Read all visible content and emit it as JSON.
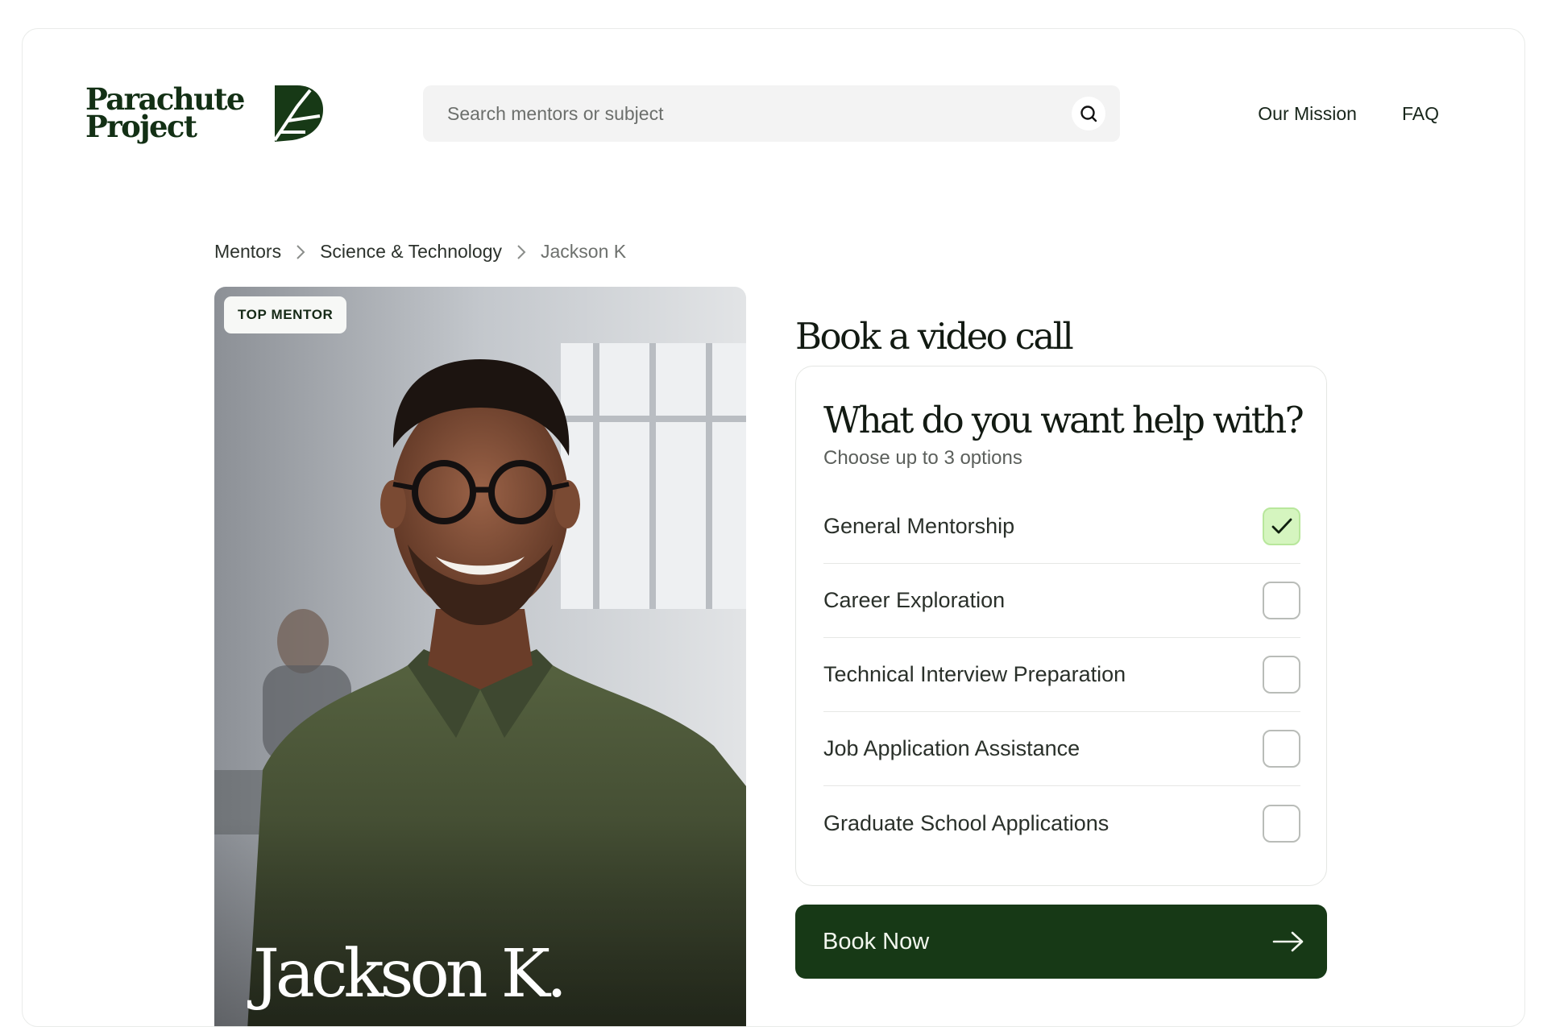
{
  "brand": {
    "line1": "Parachute",
    "line2": "Project"
  },
  "search": {
    "placeholder": "Search mentors or subject",
    "icon": "search-icon"
  },
  "nav": {
    "items": [
      {
        "label": "Our Mission"
      },
      {
        "label": "FAQ"
      }
    ]
  },
  "breadcrumb": [
    {
      "label": "Mentors"
    },
    {
      "label": "Science & Technology"
    },
    {
      "label": "Jackson K"
    }
  ],
  "mentor": {
    "badge": "TOP MENTOR",
    "name": "Jackson K."
  },
  "booking": {
    "title": "Book a video call",
    "question": "What do you want help with?",
    "hint": "Choose up to 3 options",
    "options": [
      {
        "label": "General Mentorship",
        "checked": true
      },
      {
        "label": "Career Exploration",
        "checked": false
      },
      {
        "label": "Technical Interview Preparation",
        "checked": false
      },
      {
        "label": "Job Application Assistance",
        "checked": false
      },
      {
        "label": "Graduate School Applications",
        "checked": false
      }
    ],
    "cta": "Book Now"
  },
  "colors": {
    "brand_green": "#173916",
    "check_fill": "#d5f5bf",
    "search_bg": "#f3f3f3"
  }
}
